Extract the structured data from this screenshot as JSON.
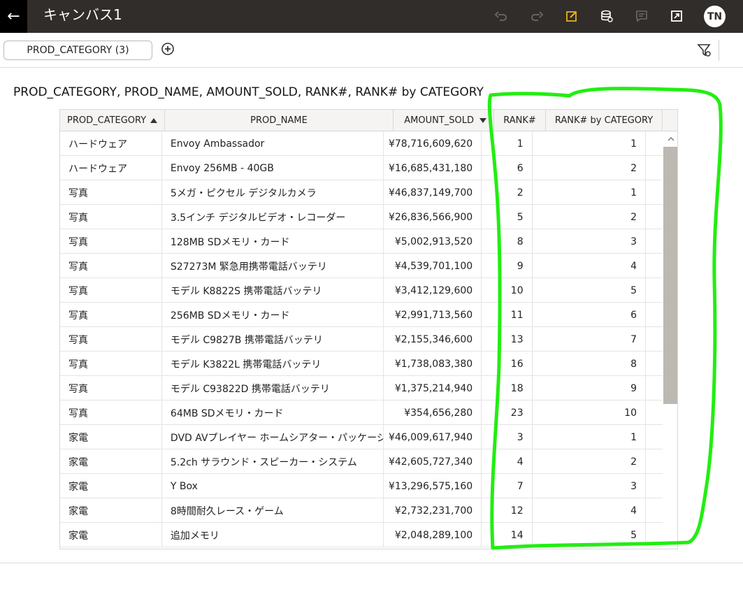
{
  "header": {
    "title": "キャンバス1",
    "avatar_initials": "TN",
    "accent_color": "#e8b01b"
  },
  "filterbar": {
    "filter_label": "PROD_CATEGORY (3)"
  },
  "viz": {
    "title": "PROD_CATEGORY, PROD_NAME, AMOUNT_SOLD, RANK#, RANK# by CATEGORY"
  },
  "table": {
    "columns": [
      "PROD_CATEGORY",
      "PROD_NAME",
      "AMOUNT_SOLD",
      "RANK#",
      "RANK# by CATEGORY"
    ],
    "rows": [
      [
        "ハードウェア",
        "Envoy Ambassador",
        "¥78,716,609,620",
        "1",
        "1"
      ],
      [
        "ハードウェア",
        "Envoy 256MB - 40GB",
        "¥16,685,431,180",
        "6",
        "2"
      ],
      [
        "写真",
        "5メガ・ピクセル デジタルカメラ",
        "¥46,837,149,700",
        "2",
        "1"
      ],
      [
        "写真",
        "3.5インチ デジタルビデオ・レコーダー",
        "¥26,836,566,900",
        "5",
        "2"
      ],
      [
        "写真",
        "128MB SDメモリ・カード",
        "¥5,002,913,520",
        "8",
        "3"
      ],
      [
        "写真",
        "S27273M 緊急用携帯電話バッテリ",
        "¥4,539,701,100",
        "9",
        "4"
      ],
      [
        "写真",
        "モデル K8822S 携帯電話バッテリ",
        "¥3,412,129,600",
        "10",
        "5"
      ],
      [
        "写真",
        "256MB SDメモリ・カード",
        "¥2,991,713,560",
        "11",
        "6"
      ],
      [
        "写真",
        "モデル C9827B 携帯電話バッテリ",
        "¥2,155,346,600",
        "13",
        "7"
      ],
      [
        "写真",
        "モデル K3822L 携帯電話バッテリ",
        "¥1,738,083,380",
        "16",
        "8"
      ],
      [
        "写真",
        "モデル C93822D 携帯電話バッテリ",
        "¥1,375,214,940",
        "18",
        "9"
      ],
      [
        "写真",
        "64MB SDメモリ・カード",
        "¥354,656,280",
        "23",
        "10"
      ],
      [
        "家電",
        "DVD AVプレイヤー ホームシアター・パッケージ",
        "¥46,009,617,940",
        "3",
        "1"
      ],
      [
        "家電",
        "5.2ch サラウンド・スピーカー・システム",
        "¥42,605,727,340",
        "4",
        "2"
      ],
      [
        "家電",
        "Y Box",
        "¥13,296,575,160",
        "7",
        "3"
      ],
      [
        "家電",
        "8時間耐久レース・ゲーム",
        "¥2,732,231,700",
        "12",
        "4"
      ],
      [
        "家電",
        "追加メモリ",
        "¥2,048,289,100",
        "14",
        "5"
      ]
    ]
  },
  "annotation": {
    "color": "#22ee11"
  }
}
